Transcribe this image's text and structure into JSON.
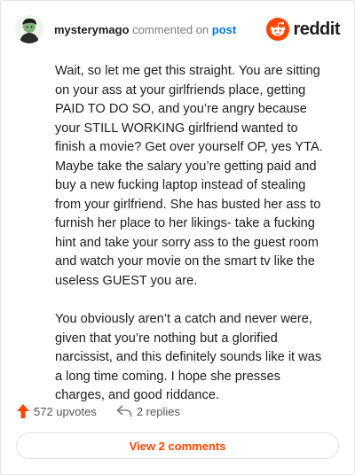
{
  "header": {
    "username": "mysterymago",
    "action_text": "commented on",
    "post_link": "post",
    "logo_text": "reddit"
  },
  "comment": {
    "paragraphs": [
      "Wait, so let me get this straight. You are sitting on your ass at your girlfriends place, getting PAID TO DO SO, and you’re angry because your STILL WORKING girlfriend wanted to finish a movie? Get over yourself OP, yes YTA. Maybe take the salary you’re getting paid and buy a new fucking laptop instead of stealing from your girlfriend. She has busted her ass to furnish her place to her likings- take a fucking hint and take your sorry ass to the guest room and watch your movie on the smart tv like the useless GUEST you are.",
      "You obviously aren’t a catch and never were, given that you’re nothing but a glorified narcissist, and this definitely sounds like it was a long time coming. I hope she presses charges, and good riddance."
    ]
  },
  "footer": {
    "upvotes": "572 upvotes",
    "replies": "2 replies",
    "view_comments": "View 2 comments"
  },
  "colors": {
    "brand_orange": "#ff4500",
    "link_blue": "#0079d3"
  },
  "icons": {
    "avatar": "user-avatar",
    "logo": "reddit-snoo-icon",
    "upvote": "upvote-arrow-icon",
    "reply": "reply-arrow-icon"
  }
}
